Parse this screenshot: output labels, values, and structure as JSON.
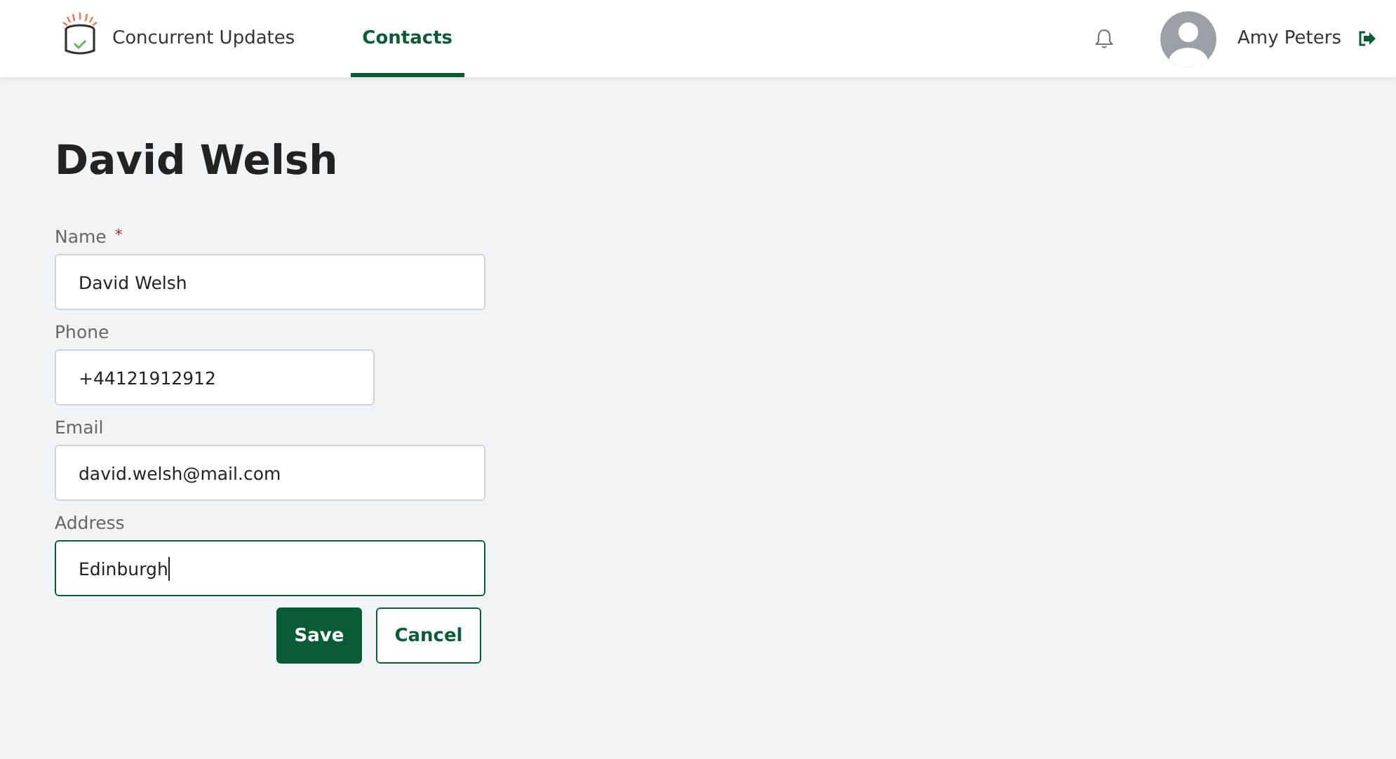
{
  "header": {
    "brand": "Concurrent Updates",
    "tabs": [
      {
        "label": "Contacts",
        "selected": true
      }
    ],
    "user": "Amy Peters"
  },
  "title": "David Welsh",
  "fields": [
    {
      "label": "Name",
      "required": true,
      "value": "David Welsh",
      "kind": "long",
      "focused": false
    },
    {
      "label": "Phone",
      "required": false,
      "value": "+44121912912",
      "kind": "short",
      "focused": false
    },
    {
      "label": "Email",
      "required": false,
      "value": "david.welsh@mail.com",
      "kind": "long",
      "focused": false
    },
    {
      "label": "Address",
      "required": false,
      "value": "Edinburgh",
      "kind": "long",
      "focused": true
    }
  ],
  "buttons": [
    {
      "label": "Save",
      "kind": "primary"
    },
    {
      "label": "Cancel",
      "kind": "secondary"
    }
  ],
  "required_mark": "*"
}
